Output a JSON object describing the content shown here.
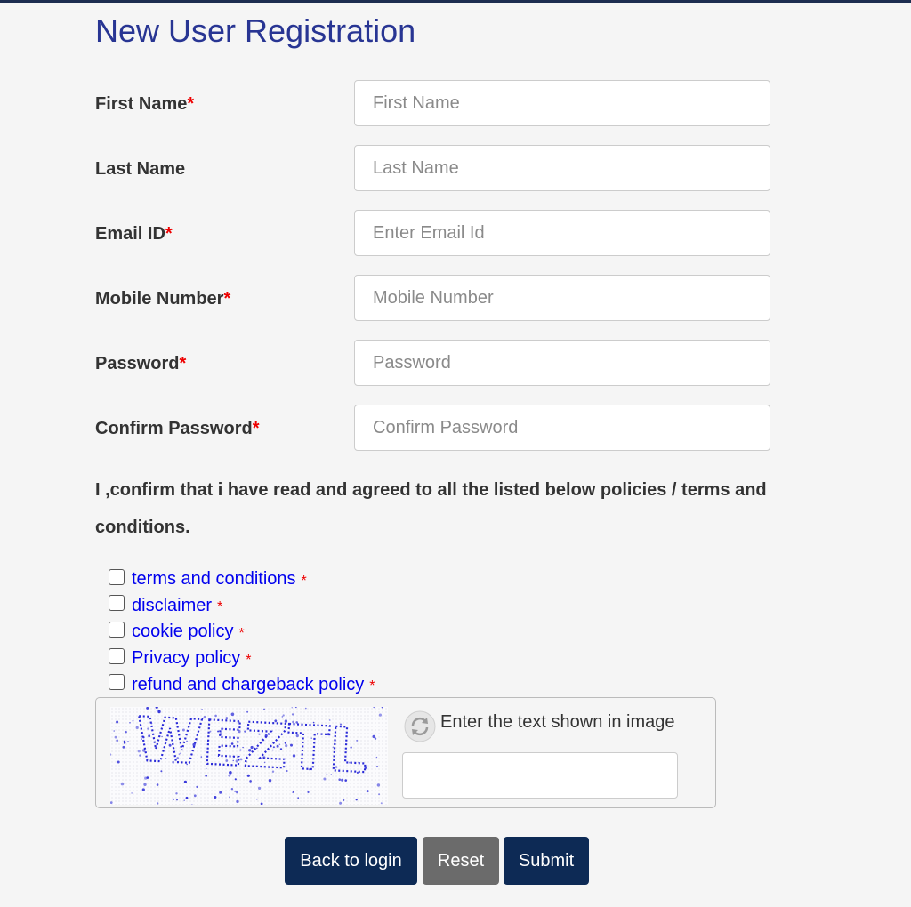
{
  "page": {
    "title": "New User Registration"
  },
  "fields": [
    {
      "label": "First Name",
      "required": "*",
      "placeholder": "First Name",
      "type": "text"
    },
    {
      "label": "Last Name",
      "required": "",
      "placeholder": "Last Name",
      "type": "text"
    },
    {
      "label": "Email ID",
      "required": "*",
      "placeholder": "Enter Email Id",
      "type": "email"
    },
    {
      "label": "Mobile Number",
      "required": "*",
      "placeholder": "Mobile Number",
      "type": "tel"
    },
    {
      "label": "Password",
      "required": "*",
      "placeholder": "Password",
      "type": "password"
    },
    {
      "label": "Confirm Password",
      "required": "*",
      "placeholder": "Confirm Password",
      "type": "password"
    }
  ],
  "agreement": {
    "text": "I ,confirm that i have read and agreed to all the listed below policies / terms and conditions.",
    "policies": [
      {
        "label": "terms and conditions",
        "required": "*"
      },
      {
        "label": "disclaimer",
        "required": "*"
      },
      {
        "label": "cookie policy",
        "required": "*"
      },
      {
        "label": "Privacy policy",
        "required": "*"
      },
      {
        "label": "refund and chargeback policy",
        "required": "*"
      }
    ]
  },
  "captcha": {
    "image_text": "WEZTL",
    "label": "Enter the text shown in image",
    "refresh_icon": "refresh-icon",
    "value": ""
  },
  "buttons": {
    "back": "Back to login",
    "reset": "Reset",
    "submit": "Submit"
  },
  "colors": {
    "title": "#283593",
    "primary_button": "#0d2a55",
    "reset_button": "#6b6b6b",
    "link": "#0000ee",
    "required": "#ee0000",
    "captcha_text": "#2a2ad8"
  }
}
